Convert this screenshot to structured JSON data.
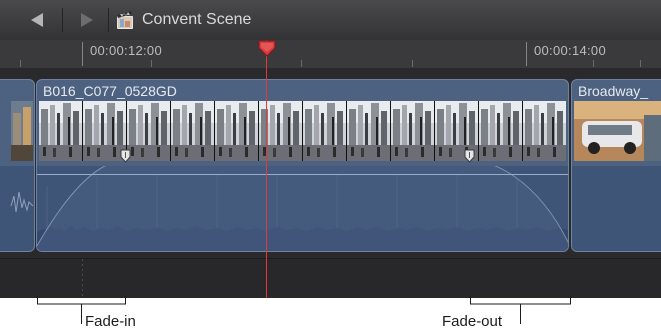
{
  "toolbar": {
    "project_title": "Convent Scene"
  },
  "ruler": {
    "timecodes": [
      "00:00:12:00",
      "00:00:14:00"
    ]
  },
  "clips": [
    {
      "name": "B016_C077_0528GD"
    },
    {
      "name": "Broadway_"
    }
  ],
  "callouts": {
    "fade_in": "Fade-in",
    "fade_out": "Fade-out"
  },
  "colors": {
    "playhead": "#e23a3a",
    "clip_fill": "#4d6280",
    "timeline_bg": "#2b2b2d"
  }
}
